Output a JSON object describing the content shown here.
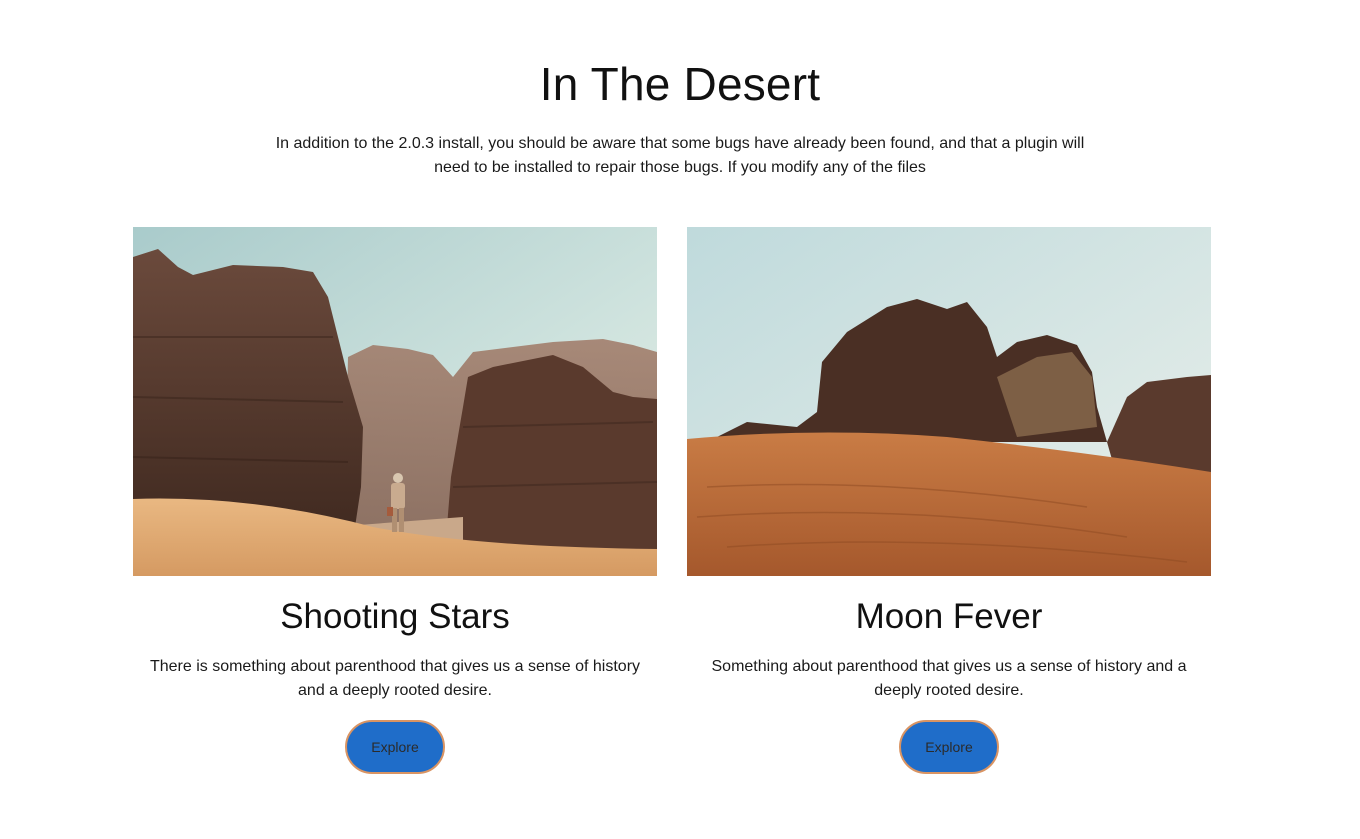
{
  "header": {
    "title": "In The Desert",
    "intro": "In addition to the 2.0.3 install, you should be aware that some bugs have already been found, and that a plugin will need to be installed to repair those bugs. If you modify any of the files"
  },
  "cards": [
    {
      "title": "Shooting Stars",
      "text": "There is something about parenthood that gives us a sense of history and a deeply rooted desire.",
      "button_label": "Explore"
    },
    {
      "title": "Moon Fever",
      "text": "Something about parenthood that gives us a sense of history and a deeply rooted desire.",
      "button_label": "Explore"
    }
  ],
  "colors": {
    "button_fill": "#1f6dc9",
    "button_border": "#d99463",
    "heading_text": "#111111"
  }
}
